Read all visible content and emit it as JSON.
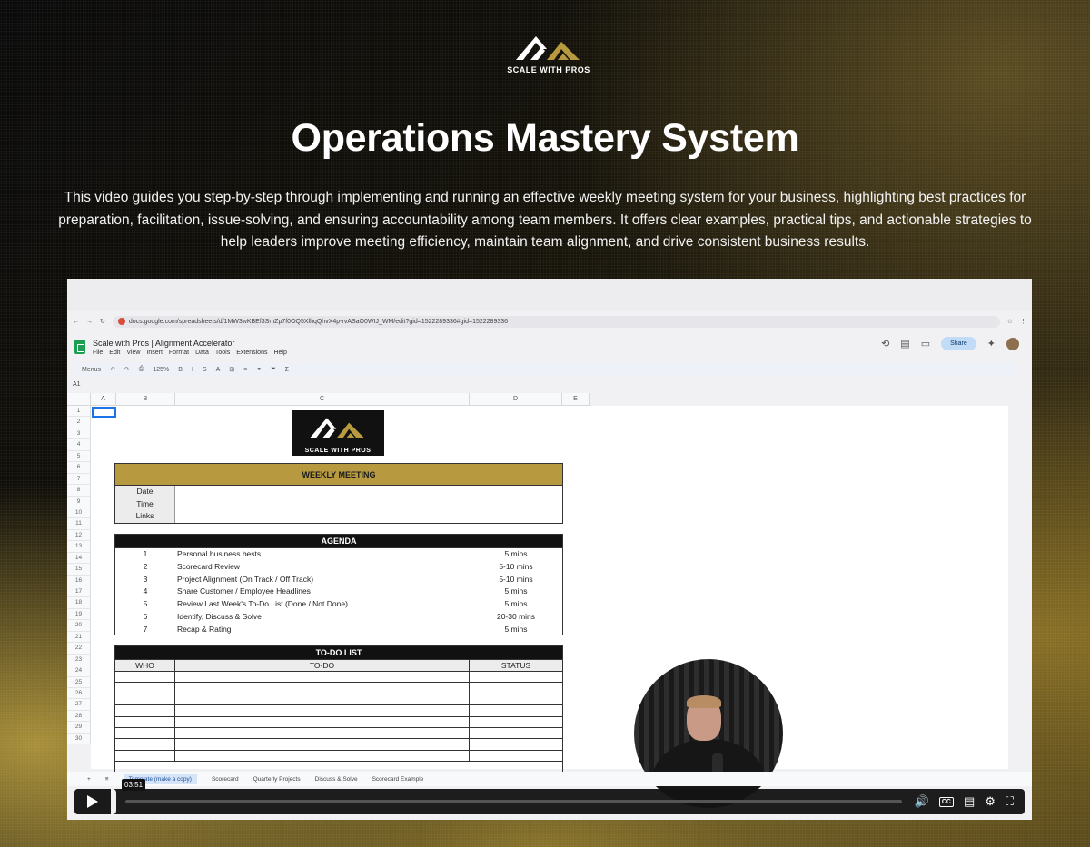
{
  "brand": {
    "name": "SCALE WITH PROS"
  },
  "hero": {
    "title": "Operations Mastery System",
    "description": "This video guides you step-by-step through implementing and running an effective weekly meeting system for your business, highlighting best practices for preparation, facilitation, issue-solving, and ensuring accountability among team members. It offers clear examples, practical tips, and actionable strategies to help leaders improve meeting efficiency, maintain team alignment, and drive consistent business results."
  },
  "browser": {
    "url": "docs.google.com/spreadsheets/d/1MW3wKBEf3SmZp7f0OQ5XlhqQhvX4p-rvASaO0WIJ_WM/edit?gid=1522289336#gid=1522289336"
  },
  "sheets": {
    "doc_title": "Scale with Pros | Alignment Accelerator",
    "menu": [
      "File",
      "Edit",
      "View",
      "Insert",
      "Format",
      "Data",
      "Tools",
      "Extensions",
      "Help"
    ],
    "share_label": "Share",
    "toolbar": {
      "search": "Menus",
      "zoom": "125%"
    },
    "name_box": "A1",
    "columns": [
      "A",
      "B",
      "C",
      "D",
      "E"
    ],
    "rows": [
      "1",
      "2",
      "3",
      "4",
      "5",
      "6",
      "7",
      "8",
      "9",
      "10",
      "11",
      "12",
      "13",
      "14",
      "15",
      "16",
      "17",
      "18",
      "19",
      "20",
      "21",
      "22",
      "23",
      "24",
      "25",
      "26",
      "27",
      "28",
      "29",
      "30"
    ],
    "weekly_meeting": {
      "title": "WEEKLY MEETING",
      "fields": [
        "Date",
        "Time",
        "Links"
      ]
    },
    "agenda": {
      "title": "AGENDA",
      "items": [
        {
          "n": "1",
          "topic": "Personal business bests",
          "time": "5 mins"
        },
        {
          "n": "2",
          "topic": "Scorecard Review",
          "time": "5-10 mins"
        },
        {
          "n": "3",
          "topic": "Project Alignment (On Track / Off Track)",
          "time": "5-10 mins"
        },
        {
          "n": "4",
          "topic": "Share Customer / Employee Headlines",
          "time": "5 mins"
        },
        {
          "n": "5",
          "topic": "Review Last Week's To-Do List (Done / Not Done)",
          "time": "5 mins"
        },
        {
          "n": "6",
          "topic": "Identify, Discuss & Solve",
          "time": "20-30 mins"
        },
        {
          "n": "7",
          "topic": "Recap & Rating",
          "time": "5 mins"
        }
      ]
    },
    "todo": {
      "title": "TO-DO LIST",
      "headers": [
        "WHO",
        "TO-DO",
        "STATUS"
      ]
    },
    "tabs": [
      "Template (make a copy)",
      "Scorecard",
      "Quarterly Projects",
      "Discuss & Solve",
      "Scorecard Example"
    ]
  },
  "player": {
    "timestamp": "03:51",
    "progress": 0.0
  }
}
